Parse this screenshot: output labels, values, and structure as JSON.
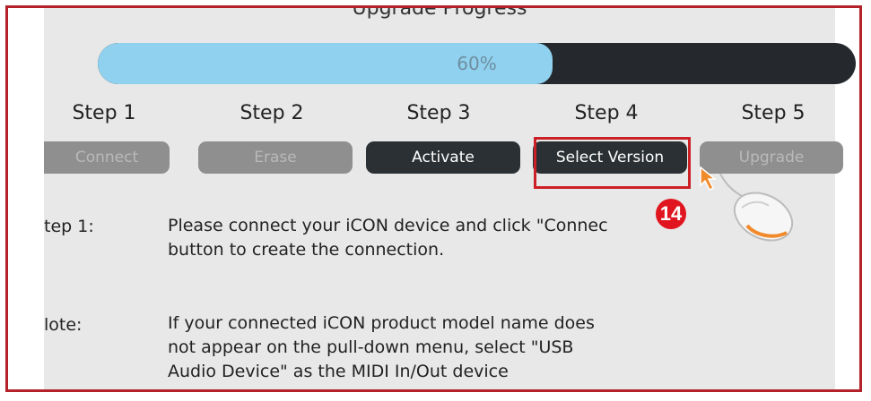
{
  "dialog": {
    "title": "Upgrade Progress"
  },
  "progress": {
    "value": 0.6,
    "label": "60%"
  },
  "steps": [
    {
      "label": "Step 1",
      "button": "Connect",
      "state": "disabled"
    },
    {
      "label": "Step 2",
      "button": "Erase",
      "state": "disabled"
    },
    {
      "label": "Step 3",
      "button": "Activate",
      "state": "active"
    },
    {
      "label": "Step 4",
      "button": "Select Version",
      "state": "active"
    },
    {
      "label": "Step 5",
      "button": "Upgrade",
      "state": "disabled"
    }
  ],
  "instructions": {
    "step_label": "tep 1:",
    "step_text_1": "Please connect your iCON device and click \"Connec",
    "step_text_2": "button to create the connection.",
    "note_label": "lote:",
    "note_text_1": "If your connected iCON product model name does",
    "note_text_2": "not appear on the pull-down menu, select \"USB",
    "note_text_3": "Audio Device\" as the MIDI In/Out device"
  },
  "callout": {
    "number": "14"
  },
  "colors": {
    "frame": "#b3222a",
    "progress_fill": "#8fd1ee",
    "progress_track": "#25292d",
    "marker": "#e0151f",
    "highlight": "#cc2027"
  }
}
